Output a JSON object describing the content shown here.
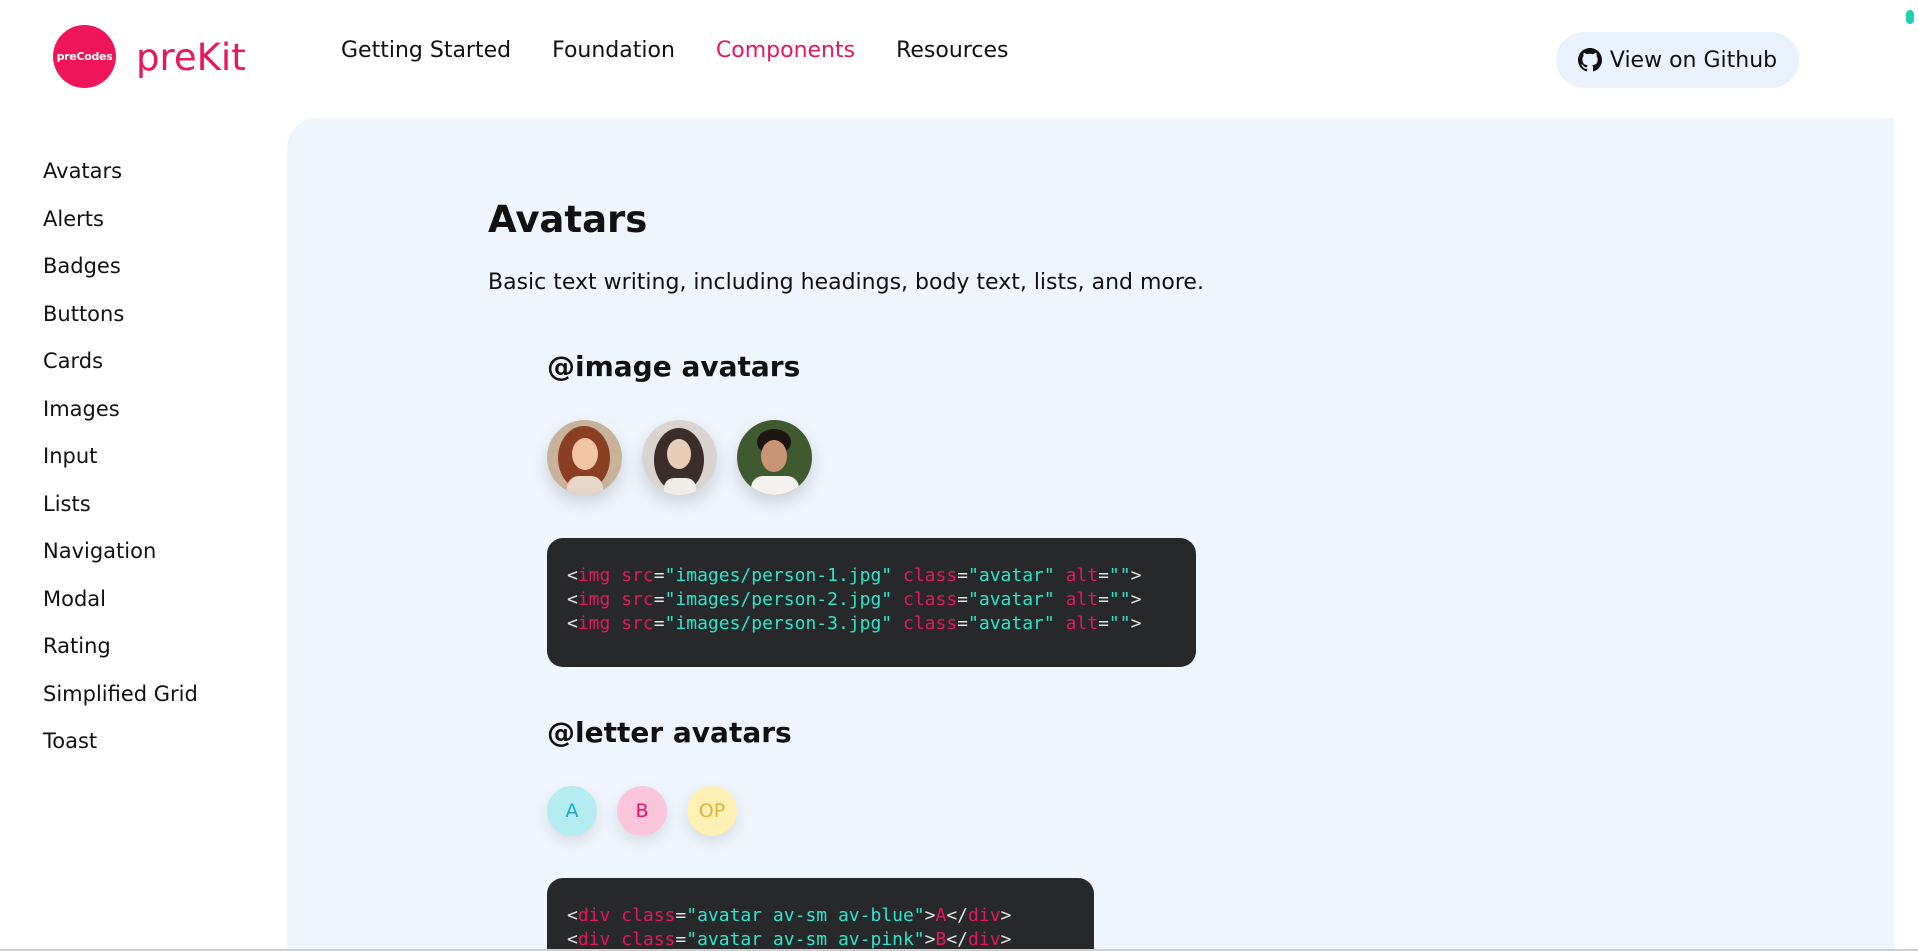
{
  "brand": {
    "logo_text": "preCodes",
    "name": "preKit"
  },
  "nav": [
    {
      "label": "Getting Started",
      "active": false
    },
    {
      "label": "Foundation",
      "active": false
    },
    {
      "label": "Components",
      "active": true
    },
    {
      "label": "Resources",
      "active": false
    }
  ],
  "github_button": {
    "label": "View on Github",
    "icon": "github-icon"
  },
  "sidebar": {
    "items": [
      "Avatars",
      "Alerts",
      "Badges",
      "Buttons",
      "Cards",
      "Images",
      "Input",
      "Lists",
      "Navigation",
      "Modal",
      "Rating",
      "Simplified Grid",
      "Toast"
    ]
  },
  "page": {
    "title": "Avatars",
    "subtitle": "Basic text writing, including headings, body text, lists, and more."
  },
  "image_avatars": {
    "heading": "@image avatars",
    "code_lines": [
      "<img src=\"images/person-1.jpg\" class=\"avatar\" alt=\"\">",
      "<img src=\"images/person-2.jpg\" class=\"avatar\" alt=\"\">",
      "<img src=\"images/person-3.jpg\" class=\"avatar\" alt=\"\">"
    ]
  },
  "letter_avatars": {
    "heading": "@letter avatars",
    "items": [
      "A",
      "B",
      "OP"
    ],
    "code_lines": [
      "<div class=\"avatar av-sm av-blue\">A</div>",
      "<div class=\"avatar av-sm av-pink\">B</div>"
    ]
  },
  "colors": {
    "accent": "#e8175d",
    "panel": "#eef5fd",
    "code_bg": "#27282a",
    "code_string": "#2ee6cf"
  }
}
